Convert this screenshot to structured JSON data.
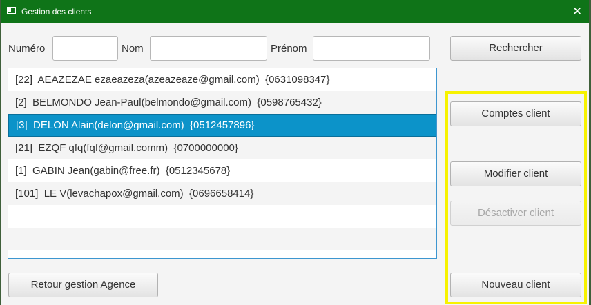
{
  "window": {
    "title": "Gestion des clients"
  },
  "search": {
    "numero_label": "Numéro",
    "numero_value": "",
    "nom_label": "Nom",
    "nom_value": "",
    "prenom_label": "Prénom",
    "prenom_value": "",
    "search_button": "Rechercher"
  },
  "clients": [
    {
      "text": "[22]  AEAZEZAE ezaeazeza(azeazeaze@gmail.com)  {0631098347}",
      "selected": false
    },
    {
      "text": "[2]  BELMONDO Jean-Paul(belmondo@gmail.com)  {0598765432}",
      "selected": false
    },
    {
      "text": "[3]  DELON Alain(delon@gmail.com)  {0512457896}",
      "selected": true
    },
    {
      "text": "[21]  EZQF qfq(fqf@gmail.comm)  {0700000000}",
      "selected": false
    },
    {
      "text": "[1]  GABIN Jean(gabin@free.fr)  {0512345678}",
      "selected": false
    },
    {
      "text": "[101]  LE V(levachapox@gmail.com)  {0696658414}",
      "selected": false
    }
  ],
  "empty_rows": 2,
  "actions": {
    "comptes_client": "Comptes client",
    "modifier_client": "Modifier client",
    "desactiver_client": "Désactiver client",
    "desactiver_enabled": false,
    "nouveau_client": "Nouveau client",
    "retour": "Retour gestion Agence"
  },
  "colors": {
    "titlebar": "#0f7418",
    "selection": "#0c93c9",
    "highlight": "#f7f200"
  },
  "icons": {
    "window_icon": "app-window-icon",
    "close": "close-icon"
  }
}
